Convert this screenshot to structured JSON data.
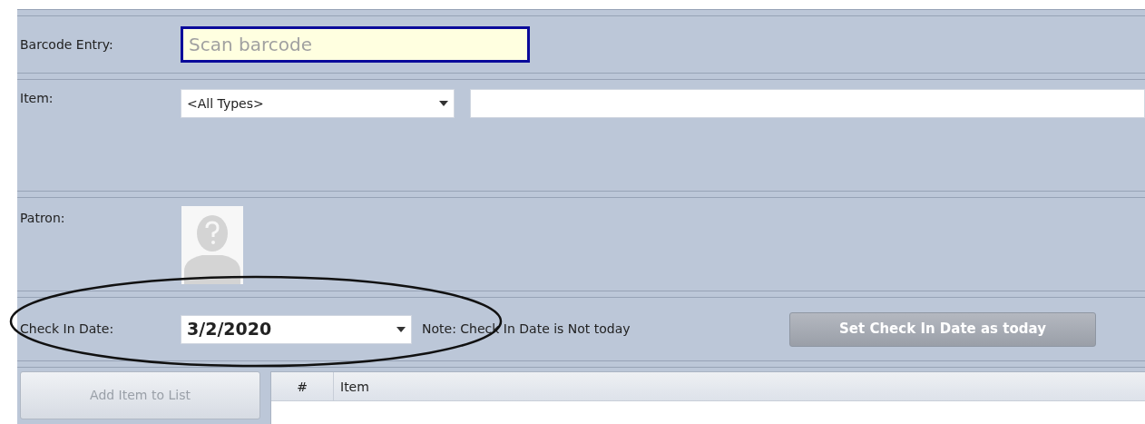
{
  "barcode_entry": {
    "label": "Barcode Entry:",
    "placeholder": "Scan barcode",
    "focused": true
  },
  "item": {
    "label": "Item:",
    "type_value": "<All Types>"
  },
  "patron": {
    "label": "Patron:"
  },
  "check_in_date": {
    "label": "Check In Date:",
    "value": "3/2/2020",
    "note": "Note: Check In Date is Not today",
    "button": "Set Check In Date as today",
    "highlighted": true
  },
  "add_button": {
    "label": "Add Item to List",
    "disabled": true
  },
  "table": {
    "columns": [
      "#",
      "Item"
    ]
  }
}
